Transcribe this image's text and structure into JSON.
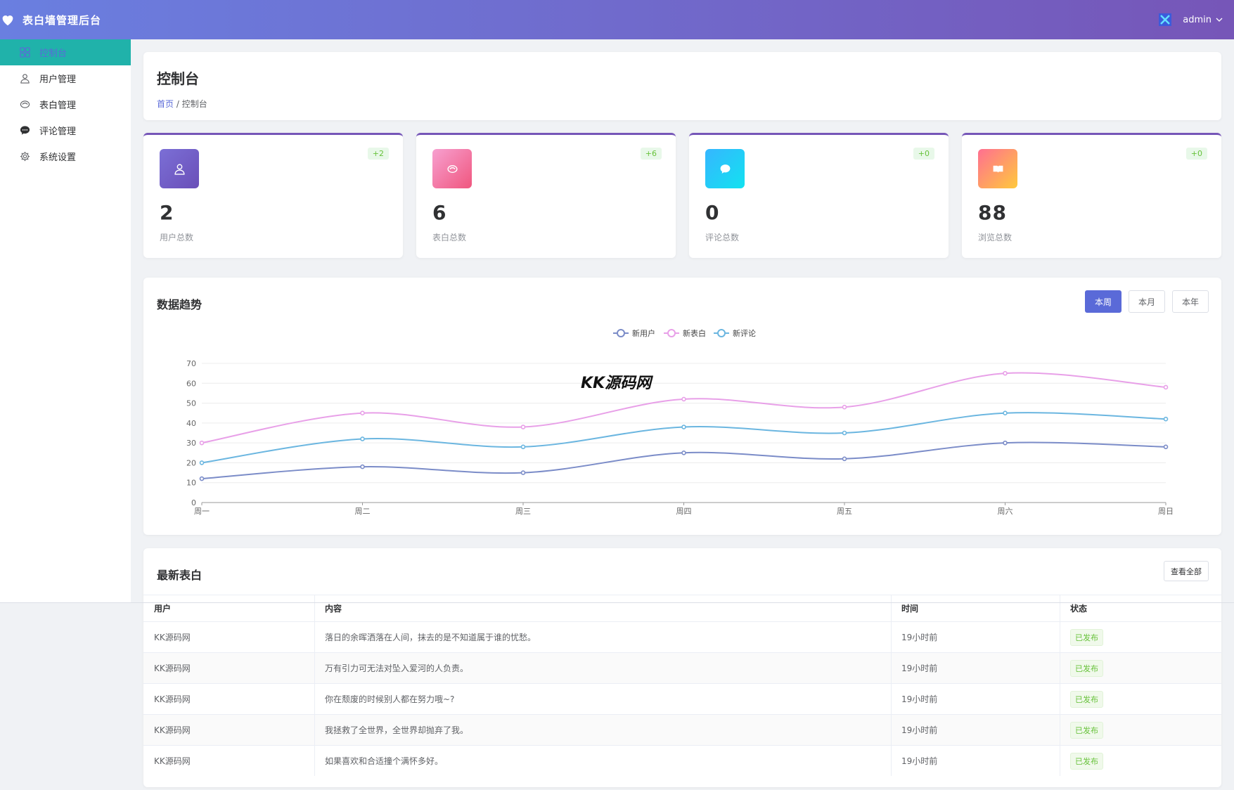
{
  "header": {
    "title": "表白墙管理后台",
    "username": "admin",
    "brand_color": "#6a7fe0",
    "brand_color_end": "#7656b8"
  },
  "sidebar": {
    "items": [
      {
        "label": "控制台",
        "icon": "dashboard-icon",
        "active": true
      },
      {
        "label": "用户管理",
        "icon": "user-icon"
      },
      {
        "label": "表白管理",
        "icon": "heart-icon"
      },
      {
        "label": "评论管理",
        "icon": "comment-icon"
      },
      {
        "label": "系统设置",
        "icon": "gear-icon"
      }
    ]
  },
  "page": {
    "title": "控制台",
    "breadcrumb": {
      "home": "首页",
      "separator": "/",
      "current": "控制台"
    }
  },
  "stats": [
    {
      "value": "2",
      "label": "用户总数",
      "badge": "+2",
      "icon": "user-icon",
      "gradient": [
        "#7b6fd6",
        "#6a4fb8"
      ]
    },
    {
      "value": "6",
      "label": "表白总数",
      "badge": "+6",
      "icon": "heart-icon",
      "gradient": [
        "#f7a0d0",
        "#f0567e"
      ]
    },
    {
      "value": "0",
      "label": "评论总数",
      "badge": "+0",
      "icon": "comment-icon",
      "gradient": [
        "#36b6ff",
        "#12e2f0"
      ]
    },
    {
      "value": "88",
      "label": "浏览总数",
      "badge": "+0",
      "icon": "book-icon",
      "gradient": [
        "#ff6f91",
        "#ffc93c"
      ]
    }
  ],
  "trend": {
    "title": "数据趋势",
    "ranges": [
      {
        "label": "本周",
        "active": true
      },
      {
        "label": "本月"
      },
      {
        "label": "本年"
      }
    ]
  },
  "chart_data": {
    "type": "line",
    "categories": [
      "周一",
      "周二",
      "周三",
      "周四",
      "周五",
      "周六",
      "周日"
    ],
    "series": [
      {
        "name": "新用户",
        "values": [
          12,
          18,
          15,
          25,
          22,
          30,
          28
        ],
        "color": "#7b8cc8"
      },
      {
        "name": "新表白",
        "values": [
          30,
          45,
          38,
          52,
          48,
          65,
          58
        ],
        "color": "#e8a0e8"
      },
      {
        "name": "新评论",
        "values": [
          20,
          32,
          28,
          38,
          35,
          45,
          42
        ],
        "color": "#6bb6e0"
      }
    ],
    "ylim": [
      0,
      70
    ],
    "yticks": [
      0,
      10,
      20,
      30,
      40,
      50,
      60,
      70
    ],
    "grid": true,
    "legend": "top-center",
    "smooth": true
  },
  "latest": {
    "title": "最新表白",
    "view_all": "查看全部",
    "columns": [
      "用户",
      "内容",
      "时间",
      "状态"
    ],
    "rows": [
      {
        "user": "KK源码网",
        "content": "落日的余晖洒落在人间，抹去的是不知道属于谁的忧愁。",
        "time": "19小时前",
        "status": "已发布"
      },
      {
        "user": "KK源码网",
        "content": "万有引力可无法对坠入爱河的人负责。",
        "time": "19小时前",
        "status": "已发布"
      },
      {
        "user": "KK源码网",
        "content": "你在颓废的时候别人都在努力哦~?",
        "time": "19小时前",
        "status": "已发布"
      },
      {
        "user": "KK源码网",
        "content": "我拯救了全世界，全世界却抛弃了我。",
        "time": "19小时前",
        "status": "已发布"
      },
      {
        "user": "KK源码网",
        "content": "如果喜欢和合适撞个满怀多好。",
        "time": "19小时前",
        "status": "已发布"
      }
    ]
  },
  "watermark": "KK源码网"
}
